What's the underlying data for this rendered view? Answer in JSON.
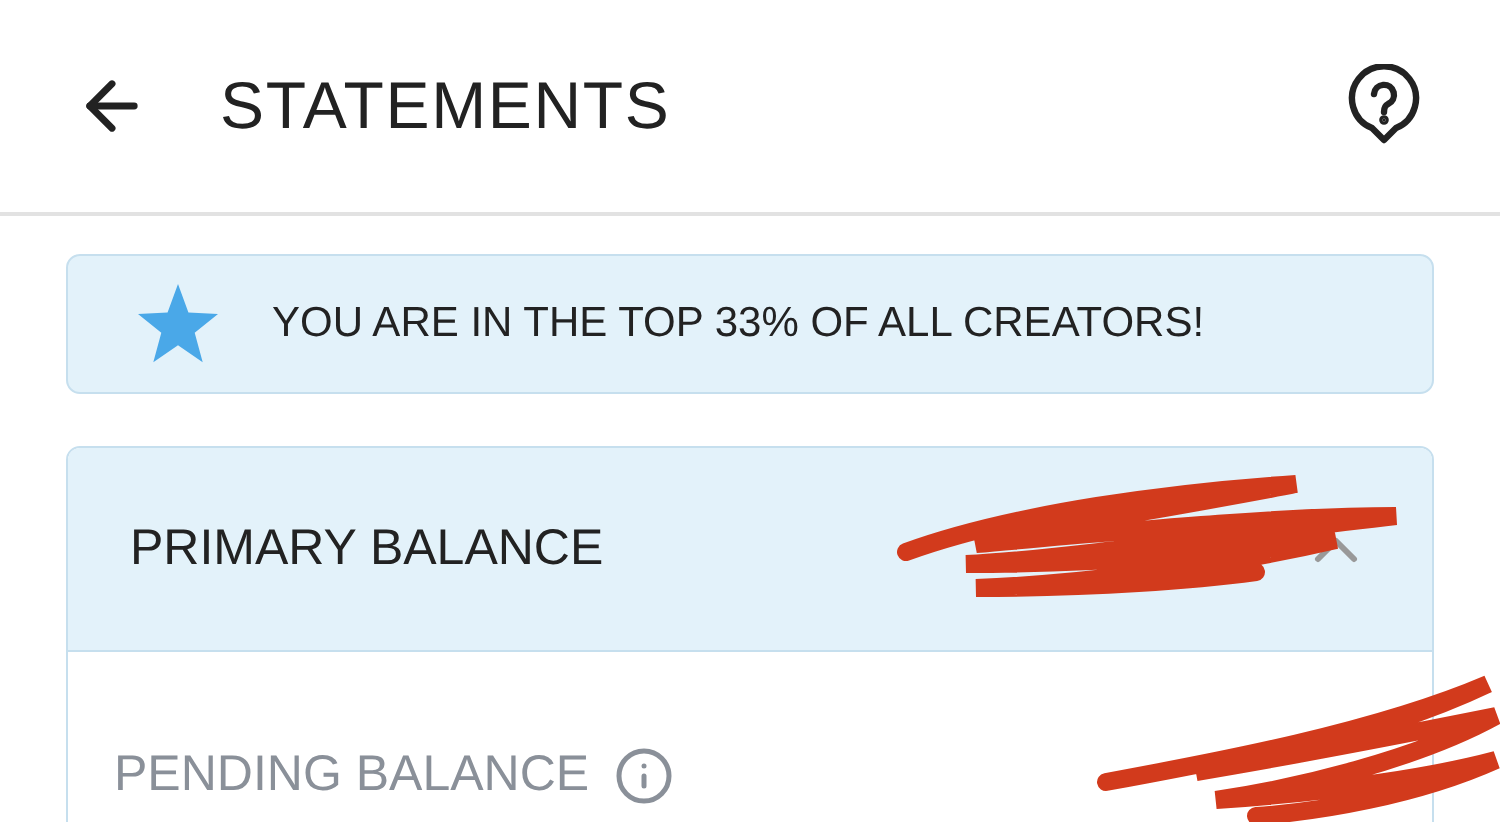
{
  "header": {
    "title": "STATEMENTS"
  },
  "banner": {
    "text": "YOU ARE IN THE TOP 33% OF ALL CREATORS!"
  },
  "balance_card": {
    "primary_label": "PRIMARY BALANCE",
    "expanded": true,
    "pending_label": "PENDING BALANCE"
  }
}
